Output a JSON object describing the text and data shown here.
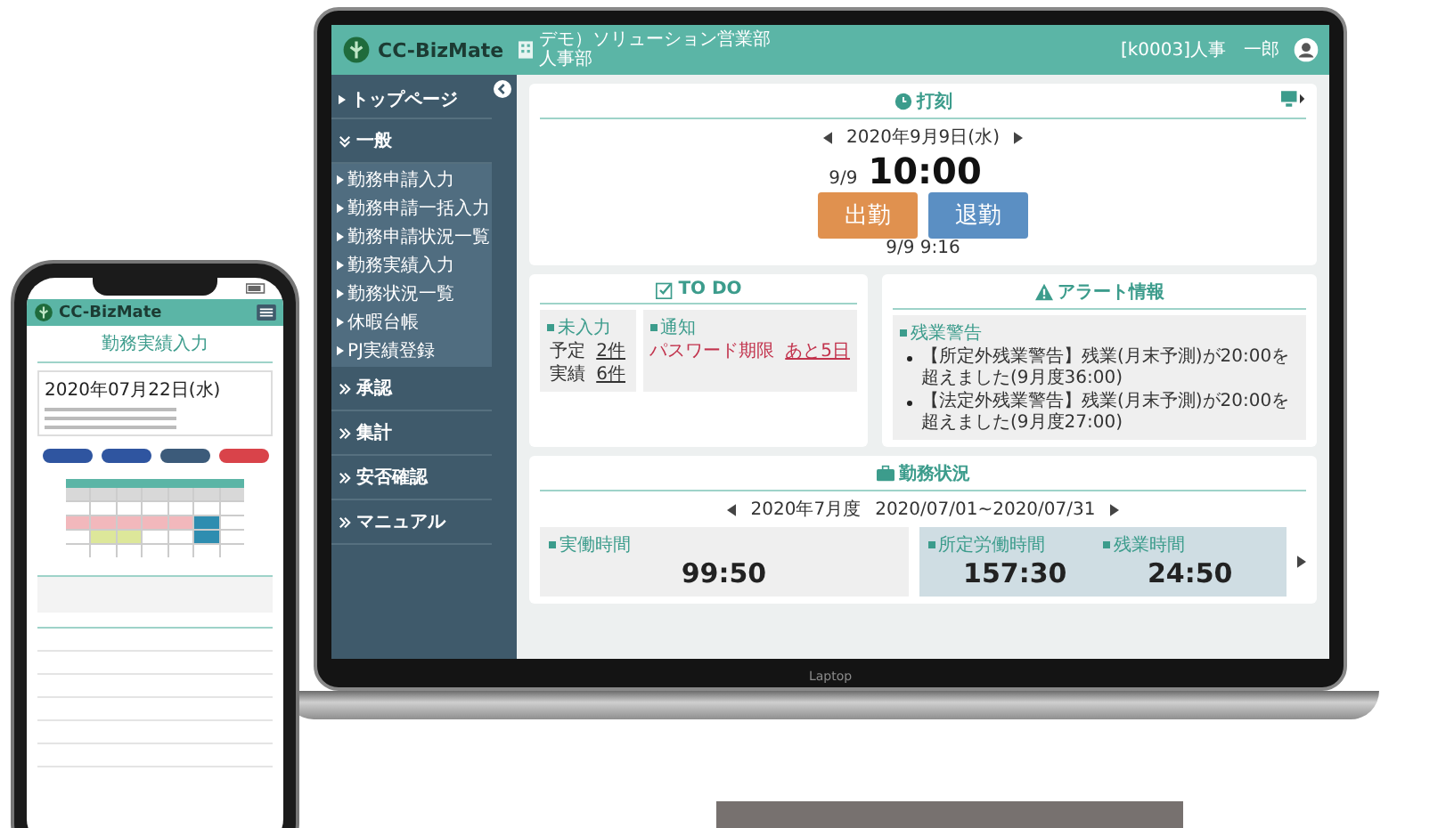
{
  "laptop": {
    "brand_label": "Laptop",
    "header": {
      "logo": "CC-BizMate",
      "org_line_1": "デモ）ソリューション営業部",
      "org_line_2": "人事部",
      "user": "[k0003]人事　一郎"
    },
    "sidebar": {
      "items": [
        {
          "kind": "page",
          "label": "トップページ"
        },
        {
          "kind": "section",
          "label": "一般",
          "expanded": true,
          "children": [
            "勤務申請入力",
            "勤務申請一括入力",
            "勤務申請状況一覧",
            "勤務実績入力",
            "勤務状況一覧",
            "休暇台帳",
            "PJ実績登録"
          ]
        },
        {
          "kind": "section",
          "label": "承認",
          "expanded": false
        },
        {
          "kind": "section",
          "label": "集計",
          "expanded": false
        },
        {
          "kind": "section",
          "label": "安否確認",
          "expanded": false
        },
        {
          "kind": "section",
          "label": "マニュアル",
          "expanded": false
        }
      ]
    },
    "punch": {
      "title": "打刻",
      "date": "2020年9月9日(水)",
      "day": "9/9",
      "time": "10:00",
      "buttons": [
        {
          "label": "出勤",
          "kind": "in"
        },
        {
          "label": "退勤",
          "kind": "out"
        }
      ],
      "last_punch": "9/9 9:16"
    },
    "todo": {
      "title": "TO DO",
      "unentered": {
        "label": "未入力",
        "rows": [
          {
            "label": "予定",
            "count": "2件"
          },
          {
            "label": "実績",
            "count": "6件"
          }
        ]
      },
      "notice": {
        "label": "通知",
        "text": "パスワード期限",
        "link": "あと5日"
      }
    },
    "alerts": {
      "title": "アラート情報",
      "label": "残業警告",
      "items": [
        "【所定外残業警告】残業(月末予測)が20:00を超えました(9月度36:00)",
        "【法定外残業警告】残業(月末予測)が20:00を超えました(9月度27:00)"
      ]
    },
    "work_status": {
      "title": "勤務状況",
      "month": "2020年7月度",
      "range": "2020/07/01~2020/07/31",
      "panels": [
        {
          "highlighted": false,
          "items": [
            {
              "label": "実働時間",
              "value": "99:50"
            }
          ]
        },
        {
          "highlighted": true,
          "items": [
            {
              "label": "所定労働時間",
              "value": "157:30"
            },
            {
              "label": "残業時間",
              "value": "24:50"
            }
          ]
        }
      ]
    }
  },
  "phone": {
    "logo": "CC-BizMate",
    "title": "勤務実績入力",
    "date": "2020年07月22日(水)"
  }
}
